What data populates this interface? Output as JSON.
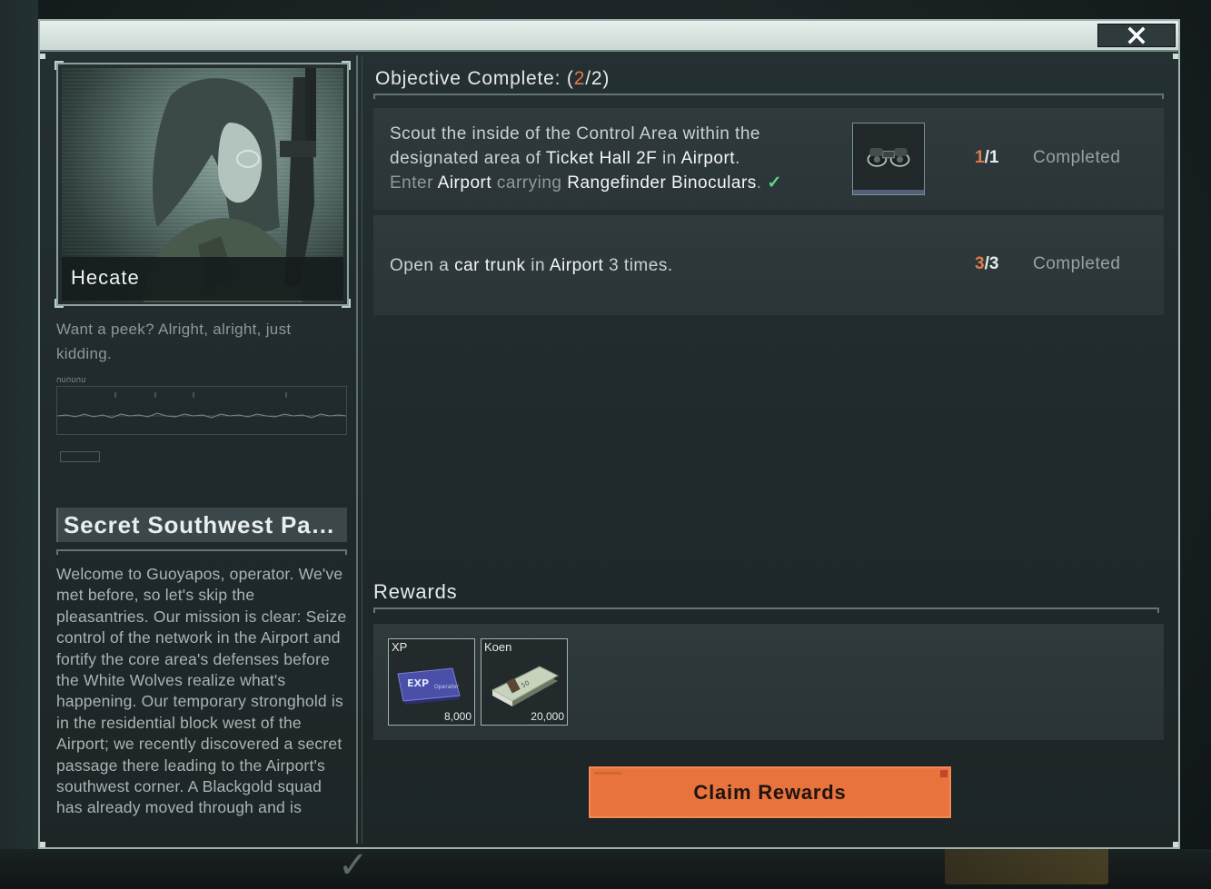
{
  "window": {
    "close_icon": "close-icon"
  },
  "character": {
    "name": "Hecate",
    "quote": "Want a peek? Alright, alright, just kidding."
  },
  "mission": {
    "title": "Secret Southwest Pass...",
    "description": "Welcome to Guoyapos, operator. We've met before, so let's skip the pleasantries. Our mission is clear: Seize control of the network in the Airport and fortify the core area's defenses before the White Wolves realize what's happening. Our temporary stronghold is in the residential block west of the Airport; we recently discovered a secret passage there leading to the Airport's southwest corner. A Blackgold squad has already moved through and is"
  },
  "objectives": {
    "header_label": "Objective Complete: (",
    "done": "2",
    "sep": "/",
    "total": "2",
    "close_paren": ")",
    "items": [
      {
        "line1_a": "Scout the inside of the Control Area within the",
        "line2_a": "designated area of ",
        "line2_hl1": "Ticket Hall 2F",
        "line2_b": " in ",
        "line2_hl2": "Airport",
        "line2_c": ".",
        "line3_dim1": "Enter ",
        "line3_hl1": "Airport",
        "line3_dim2": " carrying ",
        "line3_hl2": "Rangefinder Binoculars",
        "line3_dim3": ".",
        "check": "✓",
        "item_icon": "binoculars-icon",
        "progress_done": "1",
        "progress_total": "/1",
        "status": "Completed"
      },
      {
        "text_a": "Open a ",
        "text_hl1": "car trunk",
        "text_b": " in ",
        "text_hl2": "Airport",
        "text_c": " 3 times.",
        "progress_done": "3",
        "progress_total": "/3",
        "status": "Completed"
      }
    ]
  },
  "rewards": {
    "title": "Rewards",
    "items": [
      {
        "name": "XP",
        "amount": "8,000",
        "icon": "exp-ticket-icon"
      },
      {
        "name": "Koen",
        "amount": "20,000",
        "icon": "cash-stack-icon"
      }
    ]
  },
  "actions": {
    "claim_label": "Claim Rewards"
  },
  "colors": {
    "accent": "#e8733d",
    "progress_highlight": "#e07a4c",
    "check": "#5fd38c"
  }
}
